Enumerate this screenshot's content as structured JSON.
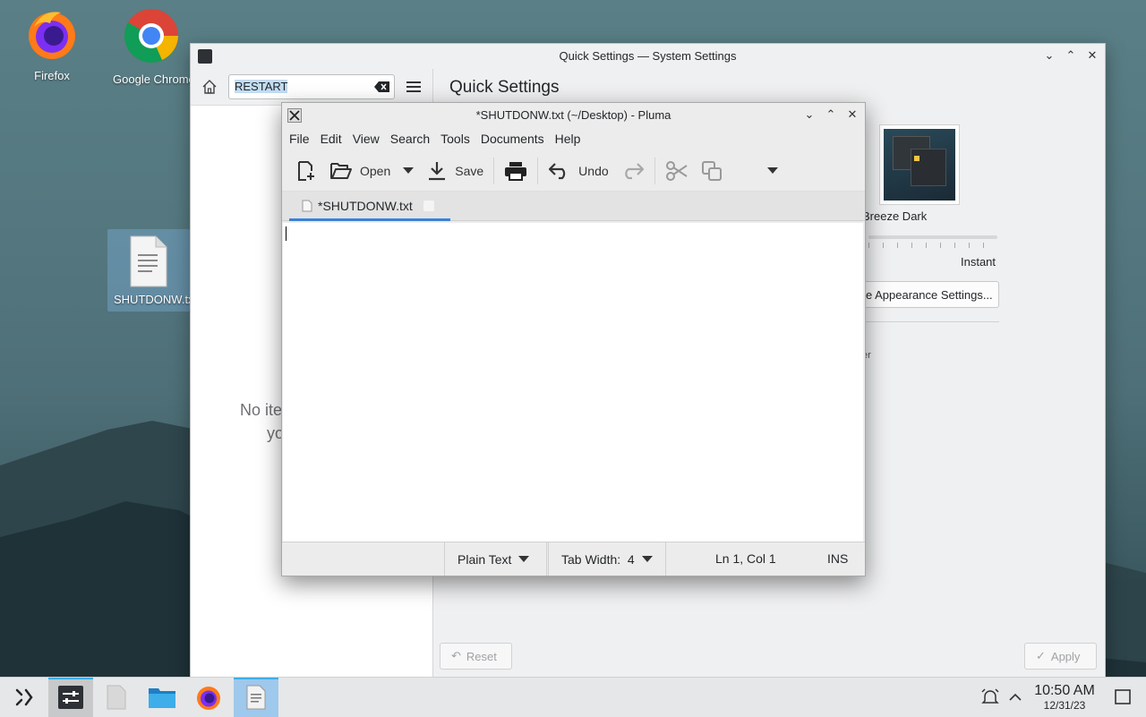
{
  "desktop": {
    "icons": [
      {
        "label": "Firefox"
      },
      {
        "label": "Google Chrome"
      },
      {
        "label": "SHUTDONW.txt"
      }
    ]
  },
  "system_settings": {
    "title": "Quick Settings — System Settings",
    "search_value": "RESTART",
    "heading": "Quick Settings",
    "theme_label": "Breeze Dark",
    "animation_speed_label": "Instant",
    "appearance_button_label": "e Appearance Settings...",
    "partial_text": "er",
    "empty_state_line1": "No ite",
    "empty_state_line2": "yo",
    "reset_label": "Reset",
    "apply_label": "Apply"
  },
  "pluma": {
    "title": "*SHUTDONW.txt (~/Desktop) - Pluma",
    "menu": [
      "File",
      "Edit",
      "View",
      "Search",
      "Tools",
      "Documents",
      "Help"
    ],
    "toolbar": {
      "open_label": "Open",
      "save_label": "Save",
      "undo_label": "Undo"
    },
    "tab_label": "*SHUTDONW.txt",
    "editor_content": "",
    "status": {
      "language": "Plain Text",
      "tab_width": "Tab Width:  4",
      "position": "Ln 1, Col 1",
      "mode": "INS"
    }
  },
  "taskbar": {
    "time": "10:50 AM",
    "date": "12/31/23"
  },
  "colors": {
    "accent": "#3daee9",
    "tab_underline": "#3b82d6"
  }
}
